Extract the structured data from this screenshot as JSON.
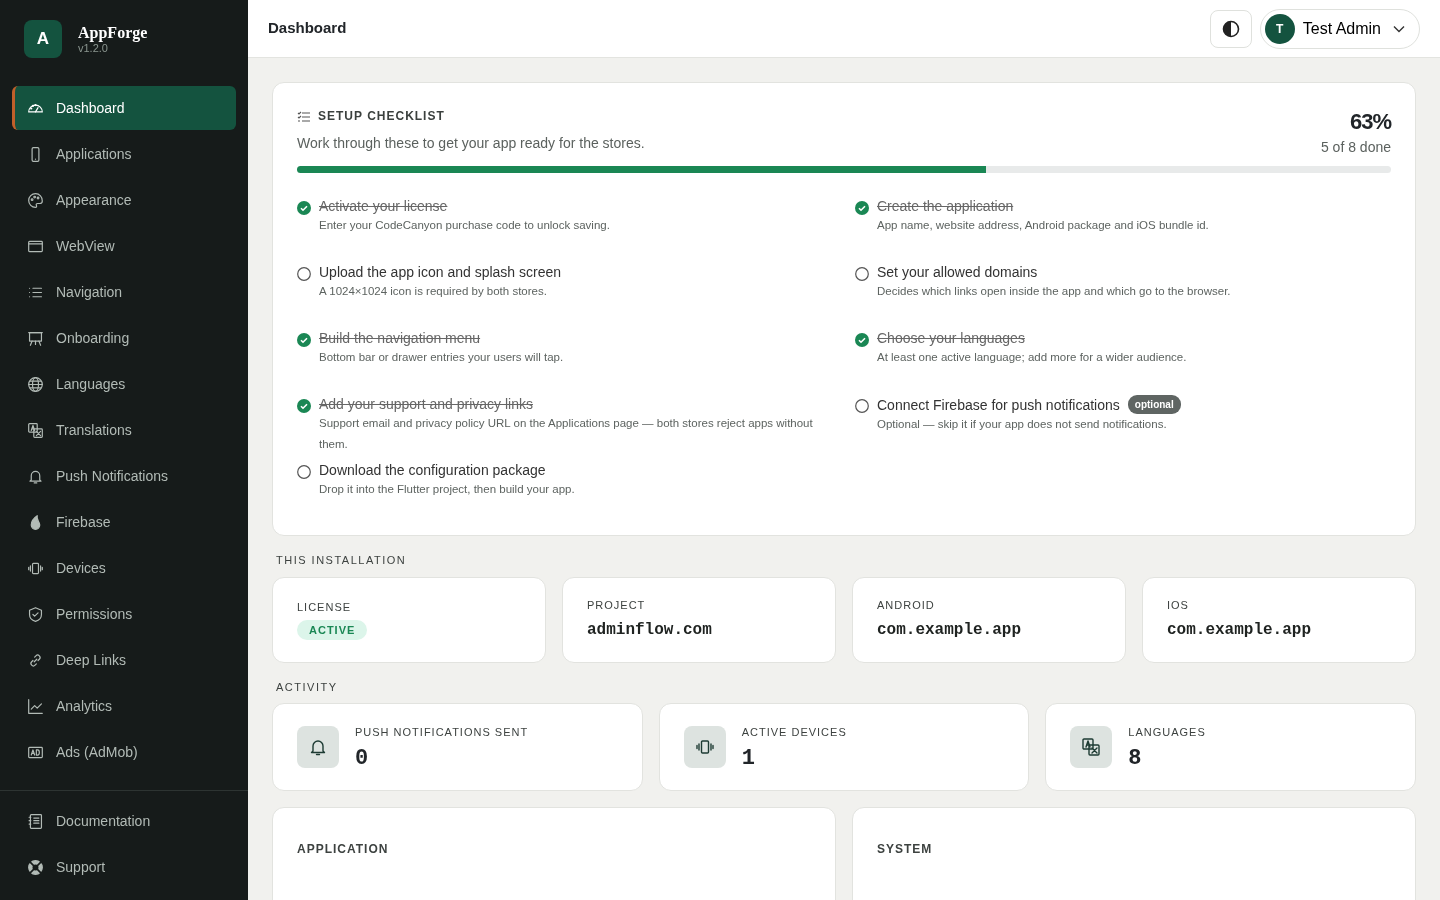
{
  "brand": {
    "logo_letter": "A",
    "name": "AppForge",
    "version": "v1.2.0"
  },
  "sidebar": {
    "items": [
      {
        "label": "Dashboard",
        "selected": true
      },
      {
        "label": "Applications",
        "selected": false
      },
      {
        "label": "Appearance",
        "selected": false
      },
      {
        "label": "WebView",
        "selected": false
      },
      {
        "label": "Navigation",
        "selected": false
      },
      {
        "label": "Onboarding",
        "selected": false
      },
      {
        "label": "Languages",
        "selected": false
      },
      {
        "label": "Translations",
        "selected": false
      },
      {
        "label": "Push Notifications",
        "selected": false
      },
      {
        "label": "Firebase",
        "selected": false
      },
      {
        "label": "Devices",
        "selected": false
      },
      {
        "label": "Permissions",
        "selected": false
      },
      {
        "label": "Deep Links",
        "selected": false
      },
      {
        "label": "Analytics",
        "selected": false
      },
      {
        "label": "Ads (AdMob)",
        "selected": false
      }
    ],
    "footer_items": [
      {
        "label": "Documentation"
      },
      {
        "label": "Support"
      }
    ]
  },
  "header": {
    "title": "Dashboard",
    "user": {
      "initial": "T",
      "name": "Test Admin"
    }
  },
  "checklist": {
    "title": "SETUP CHECKLIST",
    "subtitle": "Work through these to get your app ready for the stores.",
    "percent": "63%",
    "summary": "5 of 8 done",
    "level": 0.63,
    "items": [
      {
        "title": "Activate your license",
        "detail": "Enter your CodeCanyon purchase code to unlock saving.",
        "checked": true
      },
      {
        "title": "Create the application",
        "detail": "App name, website address, Android package and iOS bundle id.",
        "checked": true
      },
      {
        "title": "Upload the app icon and splash screen",
        "detail": "A 1024×1024 icon is required by both stores.",
        "checked": false
      },
      {
        "title": "Set your allowed domains",
        "detail": "Decides which links open inside the app and which go to the browser.",
        "checked": false
      },
      {
        "title": "Build the navigation menu",
        "detail": "Bottom bar or drawer entries your users will tap.",
        "checked": true
      },
      {
        "title": "Choose your languages",
        "detail": "At least one active language; add more for a wider audience.",
        "checked": true
      },
      {
        "title": "Add your support and privacy links",
        "detail": "Support email and privacy policy URL on the Applications page — both stores reject apps without them.",
        "checked": true
      },
      {
        "title": "Connect Firebase for push notifications",
        "badge": "optional",
        "detail": "Optional — skip it if your app does not send notifications.",
        "checked": false
      },
      {
        "title": "Download the configuration package",
        "detail": "Drop it into the Flutter project, then build your app.",
        "checked": false
      }
    ]
  },
  "installation": {
    "heading": "THIS INSTALLATION",
    "cards": [
      {
        "label": "LICENSE",
        "kind": "badge",
        "value": "ACTIVE"
      },
      {
        "label": "PROJECT",
        "kind": "code",
        "value": "adminflow.com"
      },
      {
        "label": "ANDROID",
        "kind": "code",
        "value": "com.example.app"
      },
      {
        "label": "IOS",
        "kind": "code",
        "value": "com.example.app"
      }
    ]
  },
  "activity": {
    "heading": "ACTIVITY",
    "stats": [
      {
        "label": "PUSH NOTIFICATIONS SENT",
        "value": "0"
      },
      {
        "label": "ACTIVE DEVICES",
        "value": "1"
      },
      {
        "label": "LANGUAGES",
        "value": "8"
      }
    ]
  },
  "panels": [
    {
      "title": "APPLICATION"
    },
    {
      "title": "SYSTEM"
    }
  ]
}
